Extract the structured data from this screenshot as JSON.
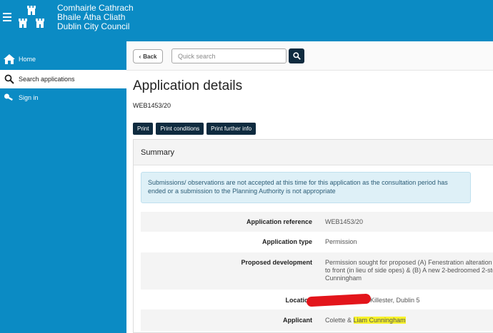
{
  "header": {
    "council_line1": "Comhairle Cathrach",
    "council_line2": "Bhaile Átha Cliath",
    "council_line3": "Dublin City Council"
  },
  "sidebar": {
    "items": [
      {
        "label": "Home",
        "icon": "home-icon"
      },
      {
        "label": "Search applications",
        "icon": "search-icon",
        "active": true
      },
      {
        "label": "Sign in",
        "icon": "key-icon"
      }
    ]
  },
  "toolbar": {
    "back_label": "Back",
    "search_placeholder": "Quick search"
  },
  "page": {
    "title": "Application details",
    "reference": "WEB1453/20"
  },
  "print_buttons": [
    "Print",
    "Print conditions",
    "Print further info"
  ],
  "summary": {
    "heading": "Summary",
    "notice_line1": "Submissions/ observations are not accepted at this time for this application as the consultation period has",
    "notice_line2": "ended or a submission to the Planning Authority is not appropriate",
    "rows": [
      {
        "label": "Application reference",
        "value": "WEB1453/20"
      },
      {
        "label": "Application type",
        "value": "Permission"
      },
      {
        "label": "Proposed development",
        "value_line1": "Permission sought for proposed  (A) Fenestration alteration",
        "value_line2": "to front (in lieu of side opes) & (B) A new 2-bedroomed 2-sto",
        "value_line3": "Cunningham"
      },
      {
        "label": "Location",
        "value": ", Killester, Dublin 5"
      },
      {
        "label": "Applicant",
        "value_prefix": "Colette & ",
        "value_highlight": "Liam Cunningham"
      }
    ]
  },
  "colors": {
    "brand_blue": "#0b8bc4",
    "dark_button": "#0f2b3f",
    "notice_bg": "#def0f7",
    "redaction": "#e3151b",
    "highlight": "#f7f22a"
  }
}
